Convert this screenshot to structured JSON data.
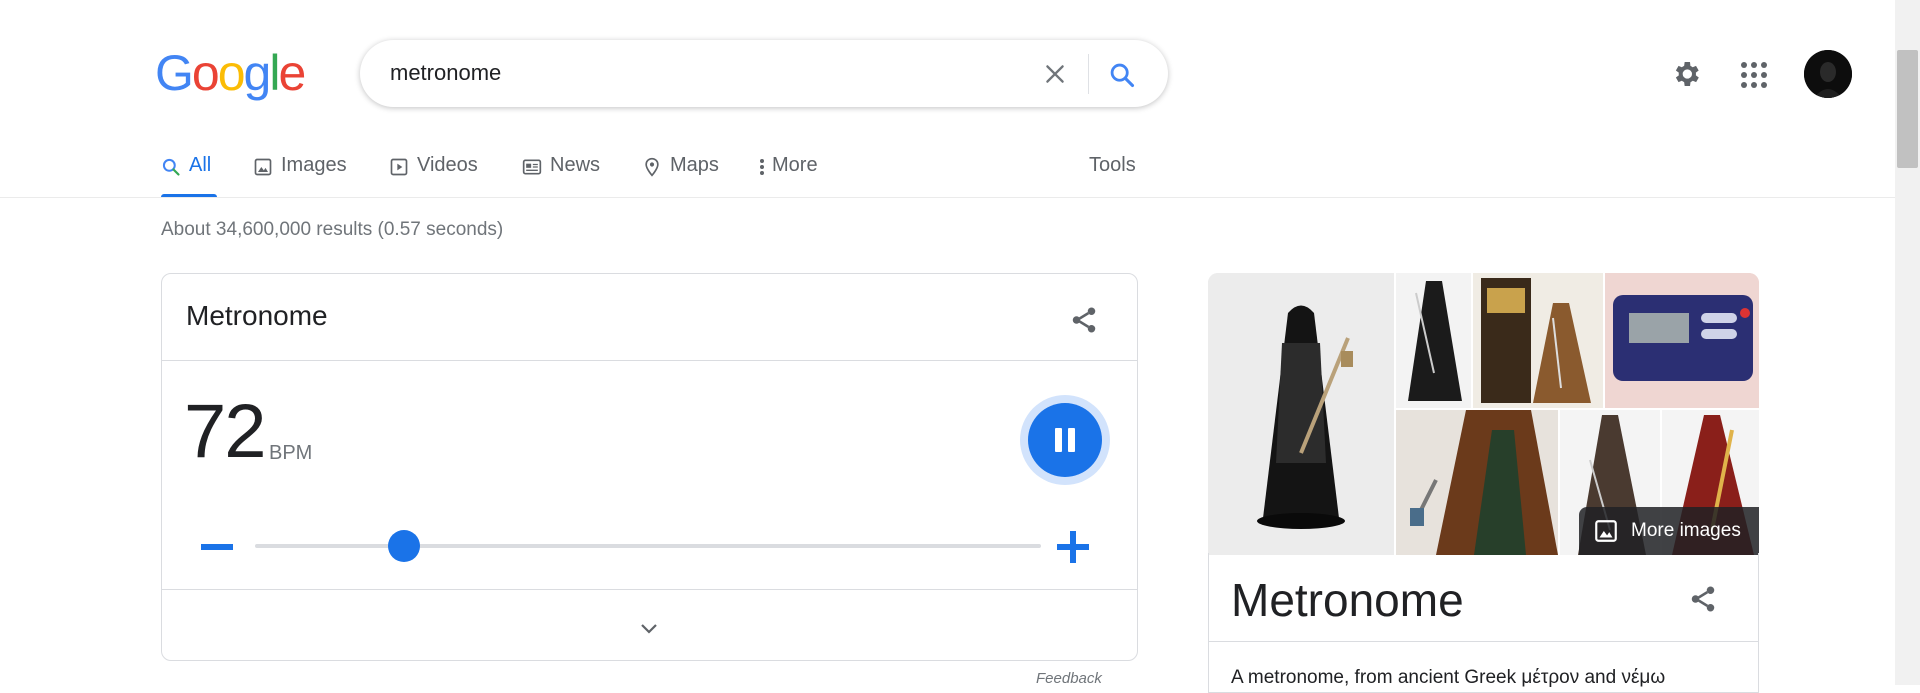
{
  "logo": {
    "letters": [
      "G",
      "o",
      "o",
      "g",
      "l",
      "e"
    ],
    "colors": [
      "#4285F4",
      "#EA4335",
      "#FBBC05",
      "#4285F4",
      "#34A853",
      "#EA4335"
    ]
  },
  "search": {
    "query": "metronome",
    "clear_icon": "close-icon",
    "submit_icon": "search-icon"
  },
  "header": {
    "settings_icon": "gear-icon",
    "apps_icon": "grid-icon",
    "account_icon": "avatar"
  },
  "tabs": [
    {
      "label": "All",
      "icon": "search-icon",
      "active": true
    },
    {
      "label": "Images",
      "icon": "image-icon"
    },
    {
      "label": "Videos",
      "icon": "play-icon"
    },
    {
      "label": "News",
      "icon": "newspaper-icon"
    },
    {
      "label": "Maps",
      "icon": "pin-icon"
    },
    {
      "label": "More",
      "icon": "dots-vertical-icon"
    }
  ],
  "tools_label": "Tools",
  "result_stats": "About 34,600,000 results (0.57 seconds)",
  "metronome": {
    "title": "Metronome",
    "bpm": "72",
    "bpm_unit": "BPM",
    "tempo_fraction": 0.19,
    "state": "playing",
    "accent_color": "#1a73e8"
  },
  "feedback": "Feedback",
  "knowledge_panel": {
    "title": "Metronome",
    "more_images": "More images",
    "description": "A metronome, from ancient Greek μέτρον and νέμω"
  }
}
